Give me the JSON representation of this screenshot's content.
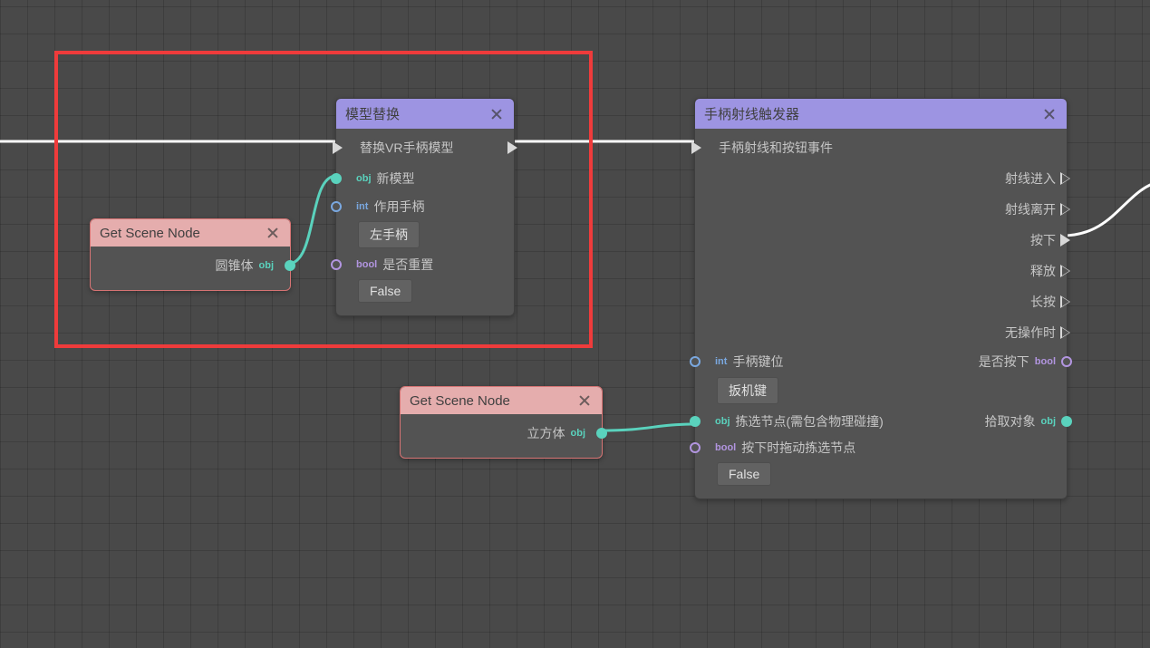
{
  "nodes": {
    "getScene1": {
      "title": "Get Scene Node",
      "output_label": "圆锥体",
      "output_type": "obj"
    },
    "getScene2": {
      "title": "Get Scene Node",
      "output_label": "立方体",
      "output_type": "obj"
    },
    "modelReplace": {
      "title": "模型替换",
      "exec_label": "替换VR手柄模型",
      "inputs": {
        "newModel": {
          "type": "obj",
          "label": "新模型"
        },
        "handle": {
          "type": "int",
          "label": "作用手柄",
          "value": "左手柄"
        },
        "reset": {
          "type": "bool",
          "label": "是否重置",
          "value": "False"
        }
      }
    },
    "rayTrigger": {
      "title": "手柄射线触发器",
      "exec_label": "手柄射线和按钮事件",
      "outputs_exec": {
        "rayEnter": "射线进入",
        "rayExit": "射线离开",
        "press": "按下",
        "release": "释放",
        "longPress": "长按",
        "idle": "无操作时"
      },
      "inputs": {
        "key": {
          "type": "int",
          "label": "手柄键位",
          "value": "扳机键"
        },
        "pick": {
          "type": "obj",
          "label": "拣选节点(需包含物理碰撞)"
        },
        "drag": {
          "type": "bool",
          "label": "按下时拖动拣选节点",
          "value": "False"
        }
      },
      "outputs_data": {
        "isPressed": {
          "type": "bool",
          "label": "是否按下"
        },
        "pickObj": {
          "type": "obj",
          "label": "拾取对象"
        }
      }
    }
  }
}
